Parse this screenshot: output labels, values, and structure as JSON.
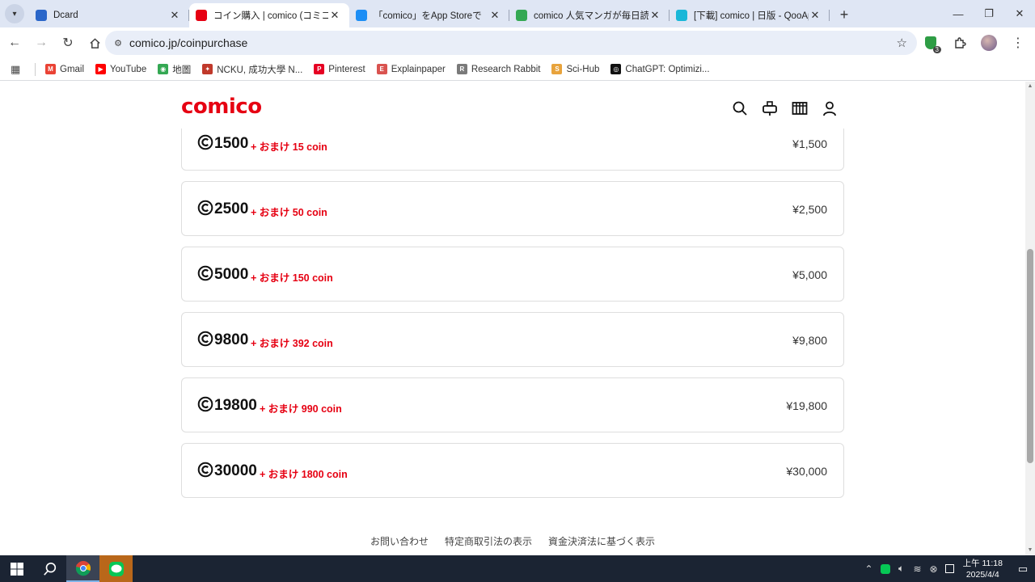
{
  "browser": {
    "tabs": [
      {
        "title": "Dcard",
        "favicon_color": "#2a66c9",
        "active": false
      },
      {
        "title": "コイン購入 | comico (コミコ)",
        "favicon_color": "#e60012",
        "active": true
      },
      {
        "title": "「comico」をApp Storeで",
        "favicon_color": "#1c8ef5",
        "active": false
      },
      {
        "title": "comico 人気マンガが毎日読め",
        "favicon_color": "#34a853",
        "active": false
      },
      {
        "title": "[下載] comico | 日版 - QooApp",
        "favicon_color": "#19b7d8",
        "active": false
      }
    ],
    "url": "comico.jp/coinpurchase",
    "extension_badge": "3",
    "bookmarks": [
      {
        "label": "Gmail",
        "color": "#ea4335",
        "glyph": "M"
      },
      {
        "label": "YouTube",
        "color": "#ff0000",
        "glyph": "▶"
      },
      {
        "label": "地圖",
        "color": "#34a853",
        "glyph": "◉"
      },
      {
        "label": "NCKU, 成功大學 N...",
        "color": "#c0392b",
        "glyph": "✦"
      },
      {
        "label": "Pinterest",
        "color": "#e60023",
        "glyph": "P"
      },
      {
        "label": "Explainpaper",
        "color": "#d9534f",
        "glyph": "E"
      },
      {
        "label": "Research Rabbit",
        "color": "#7a7a7a",
        "glyph": "R"
      },
      {
        "label": "Sci-Hub",
        "color": "#e8a33c",
        "glyph": "S"
      },
      {
        "label": "ChatGPT: Optimizi...",
        "color": "#111111",
        "glyph": "◎"
      }
    ]
  },
  "site": {
    "logo": "comico",
    "brand_color": "#e60012",
    "header_icons": [
      "search-icon",
      "mailbox-icon",
      "bookshelf-icon",
      "user-icon"
    ]
  },
  "packages": [
    {
      "amount": "1500",
      "bonus": "+ おまけ 15 coin",
      "price": "¥1,500"
    },
    {
      "amount": "2500",
      "bonus": "+ おまけ 50 coin",
      "price": "¥2,500"
    },
    {
      "amount": "5000",
      "bonus": "+ おまけ 150 coin",
      "price": "¥5,000"
    },
    {
      "amount": "9800",
      "bonus": "+ おまけ 392 coin",
      "price": "¥9,800"
    },
    {
      "amount": "19800",
      "bonus": "+ おまけ 990 coin",
      "price": "¥19,800"
    },
    {
      "amount": "30000",
      "bonus": "+ おまけ 1800 coin",
      "price": "¥30,000"
    }
  ],
  "footer": {
    "links": [
      "お問い合わせ",
      "特定商取引法の表示",
      "資金決済法に基づく表示"
    ]
  },
  "taskbar": {
    "time": "上午 11:18",
    "date": "2025/4/4"
  }
}
